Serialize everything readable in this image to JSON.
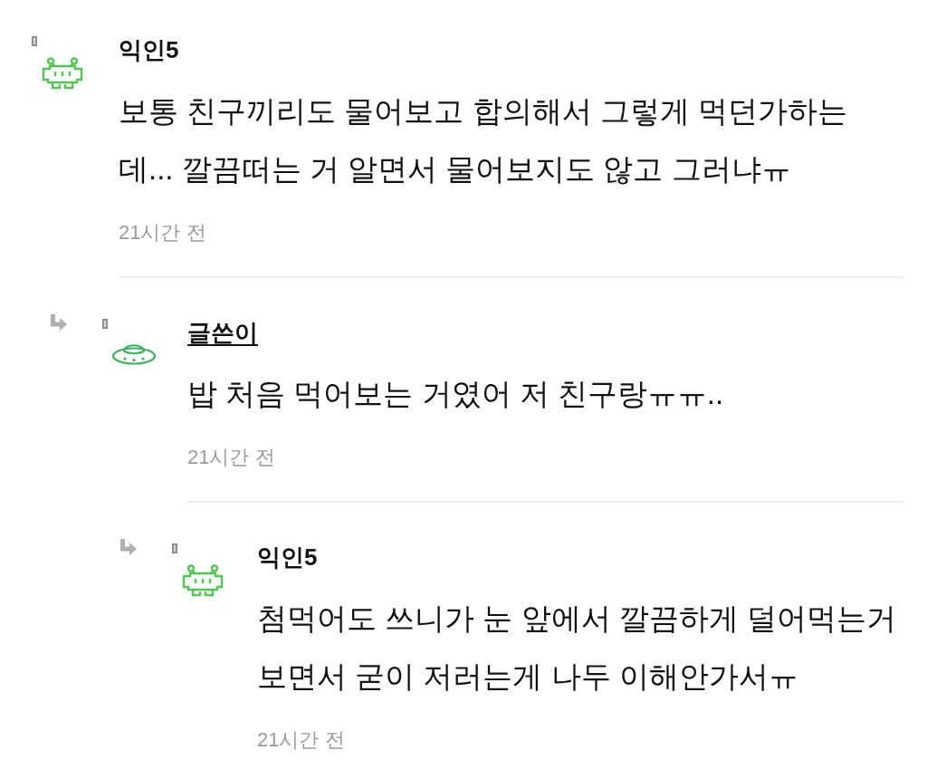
{
  "comments": [
    {
      "author": "익인5",
      "is_author": false,
      "text": "보통 친구끼리도 물어보고 합의해서 그렇게 먹던가하는데... 깔끔떠는 거 알면서 물어보지도 않고 그러냐ㅠ",
      "time": "21시간 전",
      "children": [
        {
          "author": "글쓴이",
          "is_author": true,
          "text": "밥 처음 먹어보는 거였어 저 친구랑ㅠㅠ..",
          "time": "21시간 전",
          "children": [
            {
              "author": "익인5",
              "is_author": false,
              "text": "첨먹어도 쓰니가 눈 앞에서 깔끔하게 덜어먹는거 보면서 굳이 저러는게 나두 이해안가서ㅠ",
              "time": "21시간 전"
            }
          ]
        }
      ]
    }
  ]
}
